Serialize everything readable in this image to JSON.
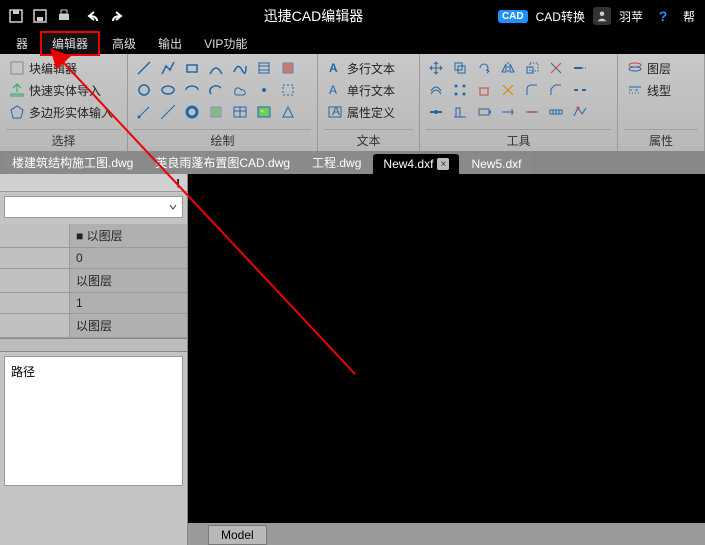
{
  "title": "迅捷CAD编辑器",
  "titlebar": {
    "cad_convert": "CAD转换",
    "user": "羽苹",
    "help": "帮"
  },
  "menu": {
    "items": [
      "器",
      "编辑器",
      "高级",
      "输出",
      "VIP功能"
    ],
    "active": 1
  },
  "ribbon": {
    "select": {
      "label": "选择",
      "block_editor": "块编辑器",
      "quick_select": "快速实体导入",
      "poly_input": "多边形实体输入"
    },
    "draw": {
      "label": "绘制"
    },
    "text": {
      "label": "文本",
      "multi": "多行文本",
      "single": "单行文本",
      "attr": "属性定义"
    },
    "tools": {
      "label": "工具"
    },
    "props": {
      "label": "属性",
      "layer": "图层",
      "ltype": "线型"
    }
  },
  "tabs": [
    {
      "name": "楼建筑结构施工图.dwg",
      "active": false
    },
    {
      "name": "英良雨蓬布置图CAD.dwg",
      "active": false
    },
    {
      "name": "工程.dwg",
      "active": false
    },
    {
      "name": "New4.dxf",
      "active": true,
      "closeable": true
    },
    {
      "name": "New5.dxf",
      "active": false
    }
  ],
  "side": {
    "rows": [
      {
        "c1": "",
        "c2": "■ 以图层"
      },
      {
        "c1": "",
        "c2": "0"
      },
      {
        "c1": "",
        "c2": "以图层"
      },
      {
        "c1": "",
        "c2": "1"
      },
      {
        "c1": "",
        "c2": "以图层"
      }
    ],
    "path": "路径"
  },
  "bottom": {
    "model": "Model"
  }
}
